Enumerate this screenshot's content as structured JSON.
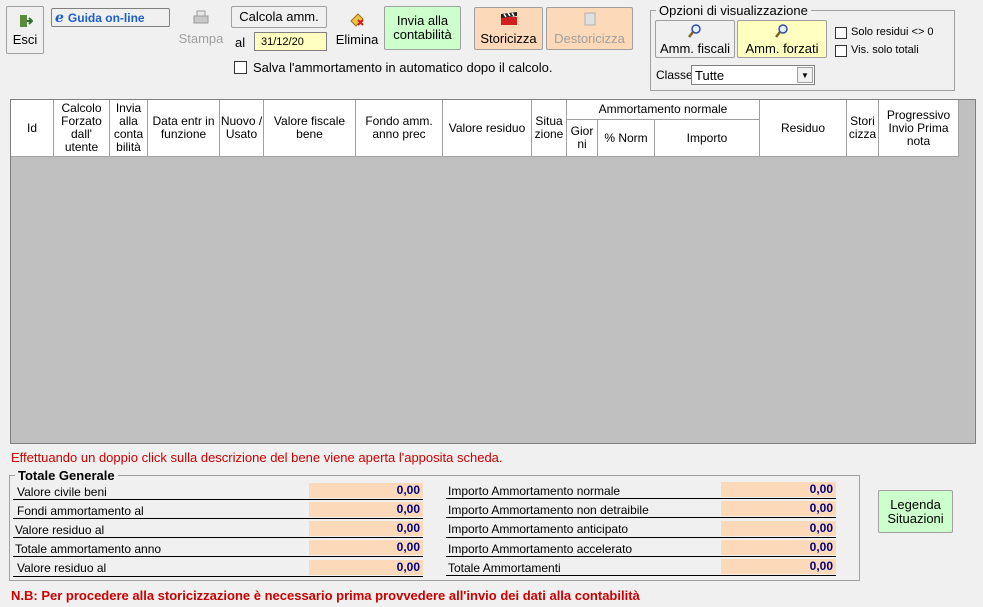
{
  "toolbar": {
    "exit_label": "Esci",
    "help_label": "Guida on-line",
    "print_label": "Stampa",
    "calc_label": "Calcola amm.",
    "date_prefix": "al",
    "date_value": "31/12/20",
    "delete_label": "Elimina",
    "send_label": "Invia alla contabilità",
    "historicize_label": "Storicizza",
    "dehistoricize_label": "Destoricizza",
    "autosave_label": "Salva l'ammortamento in automatico dopo il calcolo."
  },
  "view_options": {
    "title": "Opzioni di visualizzazione",
    "fiscal_label": "Amm. fiscali",
    "forced_label": "Amm. forzati",
    "only_residual_label": "Solo residui <> 0",
    "totals_only_label": "Vis. solo totali",
    "class_label": "Classe",
    "class_value": "Tutte"
  },
  "grid": {
    "columns": {
      "id": "Id",
      "forced": "Calcolo Forzato dall' utente",
      "sent": "Invia alla conta bilità",
      "date": "Data entr in funzione",
      "new_used": "Nuovo / Usato",
      "fiscal_value": "Valore fiscale bene",
      "fund": "Fondo amm. anno prec",
      "residual_value": "Valore residuo",
      "situation": "Situa zione",
      "normal_group": "Ammortamento normale",
      "days": "Gior ni",
      "pct": "% Norm",
      "amount": "Importo",
      "residual": "Residuo",
      "historicized": "Stori cizza",
      "progressive": "Progressivo Invio Prima nota"
    }
  },
  "info_text": "Effettuando un doppio click sulla descrizione del bene viene aperta l'apposita scheda.",
  "totals": {
    "title": "Totale Generale",
    "left": [
      {
        "label": "Valore civile beni",
        "value": "0,00"
      },
      {
        "label": "Fondi ammortamento al",
        "value": "0,00"
      },
      {
        "label": "Valore residuo al",
        "value": "0,00"
      },
      {
        "label": "Totale ammortamento anno",
        "value": "0,00"
      },
      {
        "label": "Valore residuo al",
        "value": "0,00"
      }
    ],
    "right": [
      {
        "label": "Importo Ammortamento normale",
        "value": "0,00"
      },
      {
        "label": "Importo Ammortamento non detraibile",
        "value": "0,00"
      },
      {
        "label": "Importo Ammortamento anticipato",
        "value": "0,00"
      },
      {
        "label": "Importo Ammortamento accelerato",
        "value": "0,00"
      },
      {
        "label": "Totale Ammortamenti",
        "value": "0,00"
      }
    ]
  },
  "legend_label": "Legenda Situazioni",
  "footer_note": "N.B: Per procedere alla storicizzazione è necessario prima provvedere all'invio dei dati alla contabilità",
  "colors": {
    "accent_red": "#cc0000",
    "value_blue": "#000080",
    "peach": "#fcd9b8",
    "green": "#ccffcc"
  }
}
